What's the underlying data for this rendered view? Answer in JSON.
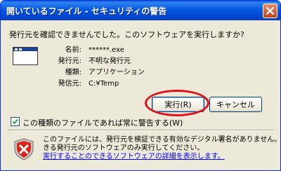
{
  "window": {
    "title": "開いているファイル - セキュリティの警告",
    "close_icon": "close-icon"
  },
  "dialog": {
    "question": "発行元を確認できませんでした。このソフトウェアを実行しますか?",
    "info": [
      {
        "label": "名前:",
        "value": "******.exe"
      },
      {
        "label": "発行元:",
        "value": "不明な発行元"
      },
      {
        "label": "種類:",
        "value": "アプリケーション"
      },
      {
        "label": "発信元:",
        "value": "C:¥Temp"
      }
    ],
    "run_label": "実行(R)",
    "cancel_label": "キャンセル",
    "checkbox_label": "この種類のファイルであれば常に警告する(W)",
    "checkbox_checked": true,
    "warning_line1": "このファイルには、発行元を検証できる有効なデジタル署名がありません。信頼で",
    "warning_line2": "きる発行元のソフトウェアのみ実行してください。",
    "warning_link": "実行することのできるソフトウェアの詳細を表示します。"
  },
  "colors": {
    "title_bar": "#0558e0",
    "highlight": "#e0111b",
    "link": "#0000ff"
  }
}
